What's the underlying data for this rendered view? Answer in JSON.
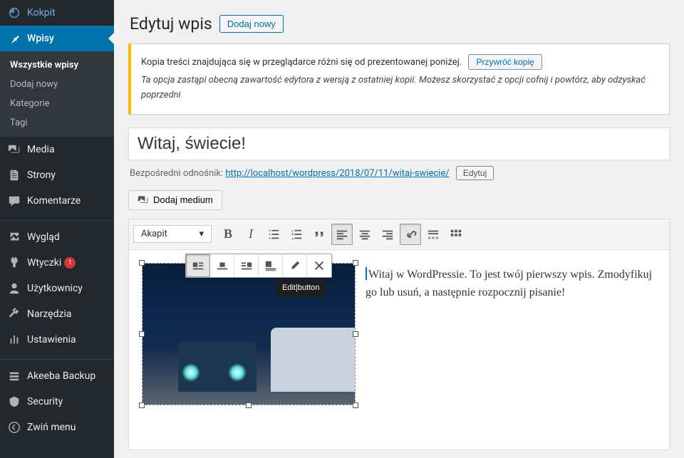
{
  "sidebar": {
    "items": [
      {
        "label": "Kokpit",
        "icon": "dashboard"
      },
      {
        "label": "Wpisy",
        "icon": "pin",
        "current": true,
        "submenu": [
          {
            "label": "Wszystkie wpisy",
            "active": true
          },
          {
            "label": "Dodaj nowy"
          },
          {
            "label": "Kategorie"
          },
          {
            "label": "Tagi"
          }
        ]
      },
      {
        "label": "Media",
        "icon": "media"
      },
      {
        "label": "Strony",
        "icon": "pages"
      },
      {
        "label": "Komentarze",
        "icon": "comments"
      },
      {
        "sep": true
      },
      {
        "label": "Wygląd",
        "icon": "appearance"
      },
      {
        "label": "Wtyczki",
        "icon": "plugins",
        "badge": "1"
      },
      {
        "label": "Użytkownicy",
        "icon": "users"
      },
      {
        "label": "Narzędzia",
        "icon": "tools"
      },
      {
        "label": "Ustawienia",
        "icon": "settings"
      },
      {
        "sep": true
      },
      {
        "label": "Akeeba Backup",
        "icon": "backup"
      },
      {
        "label": "Security",
        "icon": "security"
      },
      {
        "label": "Zwiń menu",
        "icon": "collapse"
      }
    ]
  },
  "header": {
    "title": "Edytuj wpis",
    "add_new": "Dodaj nowy"
  },
  "notice": {
    "line1": "Kopia treści znajdująca się w przeglądarce różni się od prezentowanej poniżej.",
    "restore": "Przywróć kopię",
    "line2": "Ta opcja zastąpi obecną zawartość edytora z wersją z ostatniej kopii. Możesz skorzystać z opcji cofnij i powtórz, aby odzyskać poprzedni"
  },
  "post": {
    "title": "Witaj, świecie!",
    "permalink_label": "Bezpośredni odnośnik:",
    "permalink_base": "http://localhost/wordpress/2018/07/11/",
    "permalink_slug": "witaj-swiecie",
    "permalink_tail": "/",
    "edit": "Edytuj"
  },
  "media_button": "Dodaj medium",
  "toolbar": {
    "format": "Akapit"
  },
  "image_toolbar": {
    "tooltip": "Edit|button"
  },
  "content": {
    "paragraph": "Witaj w WordPressie. To jest twój pierwszy wpis. Zmodyfikuj go lub usuń, a następnie rozpocznij pisanie!"
  }
}
